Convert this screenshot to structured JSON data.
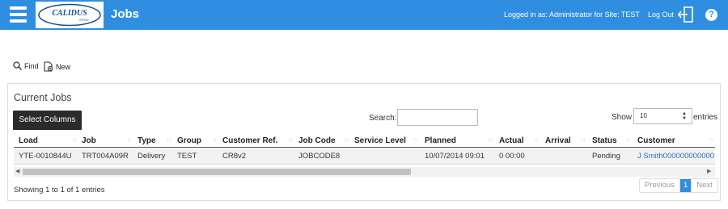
{
  "header": {
    "logo_text": "CALIDUS",
    "logo_subtext": "EPOD",
    "title": "Jobs",
    "logged_in_text": "Logged in as: Administrator for Site: TEST",
    "logout_label": "Log Out",
    "help_label": "?"
  },
  "toolbar": {
    "find_label": "Find",
    "new_label": "New"
  },
  "panel": {
    "title": "Current Jobs",
    "select_columns_label": "Select Columns",
    "search_label": "Search:",
    "search_value": "",
    "show_label": "Show",
    "page_size": "10",
    "entries_label": "entries"
  },
  "table": {
    "columns": [
      "Load",
      "Job",
      "Type",
      "Group",
      "Customer Ref.",
      "Job Code",
      "Service Level",
      "Planned",
      "Actual",
      "Arrival",
      "Status",
      "Customer"
    ],
    "rows": [
      [
        "YTE-0010844U",
        "TRT004A09R",
        "Delivery",
        "TEST",
        "CR8v2",
        "JOBCODE8",
        "",
        "10/07/2014 09:01",
        "0 00:00",
        "",
        "Pending",
        "J Smith000000000000"
      ]
    ]
  },
  "footer": {
    "showing_text": "Showing 1 to 1 of 1 entries",
    "prev_label": "Previous",
    "current_page": "1",
    "next_label": "Next"
  },
  "colors": {
    "header_bg": "#2f8ee0",
    "link": "#2f6fb8",
    "button_dark": "#2b2b2b"
  }
}
